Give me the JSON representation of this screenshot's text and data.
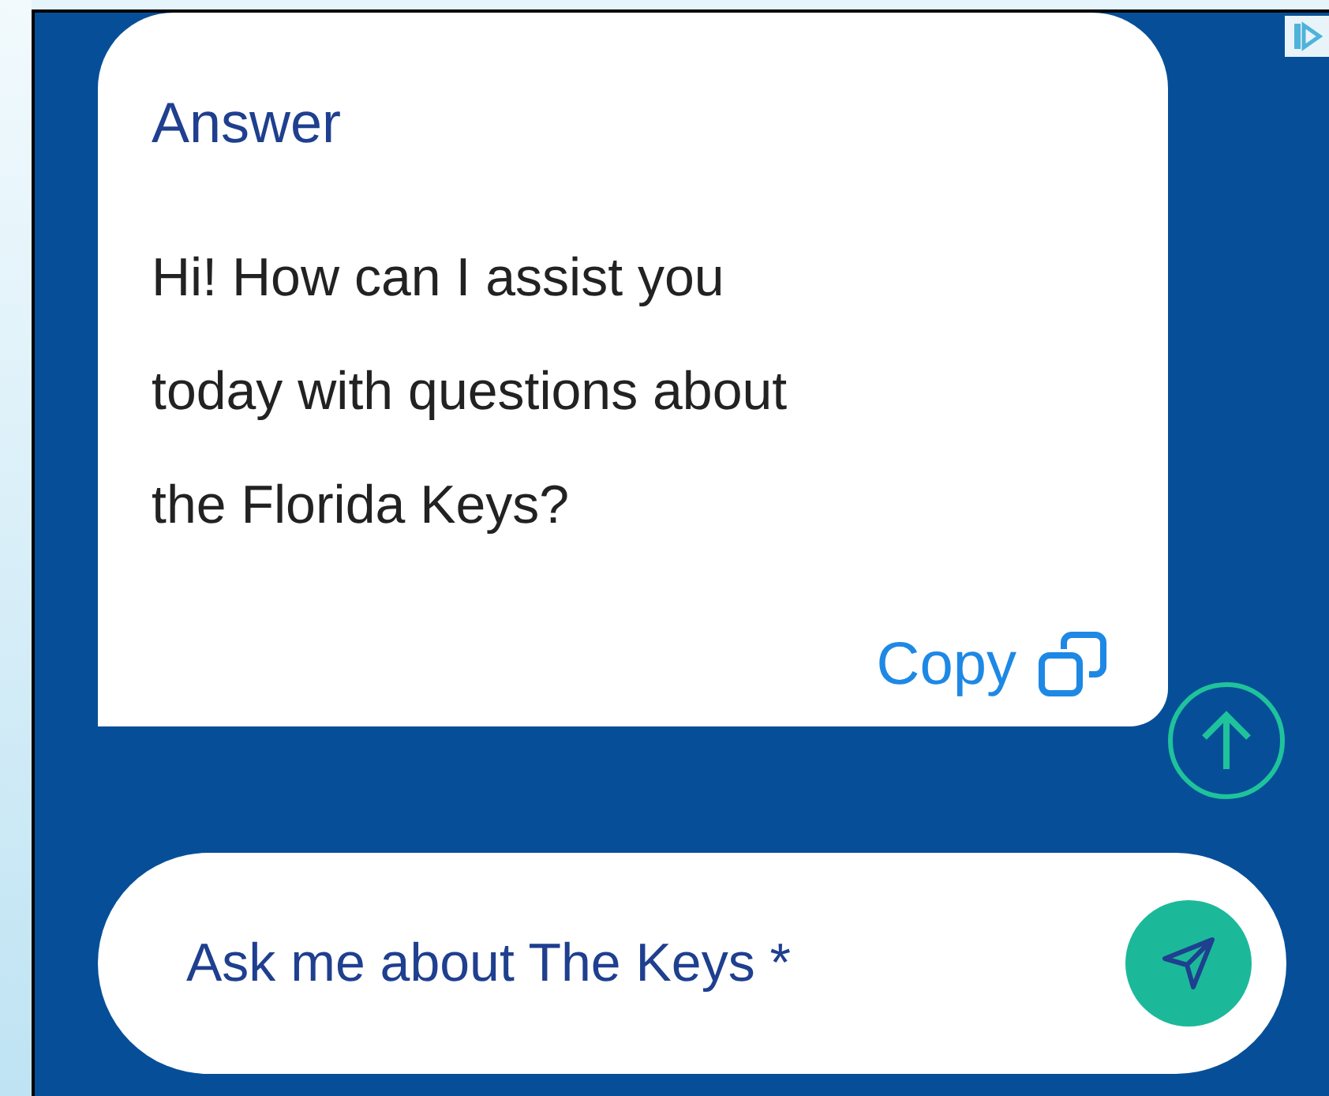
{
  "answer": {
    "heading": "Answer",
    "text": "Hi! How can I assist you today with questions about the Florida Keys?",
    "copy_label": "Copy"
  },
  "input": {
    "placeholder": "Ask me about The Keys *"
  }
}
